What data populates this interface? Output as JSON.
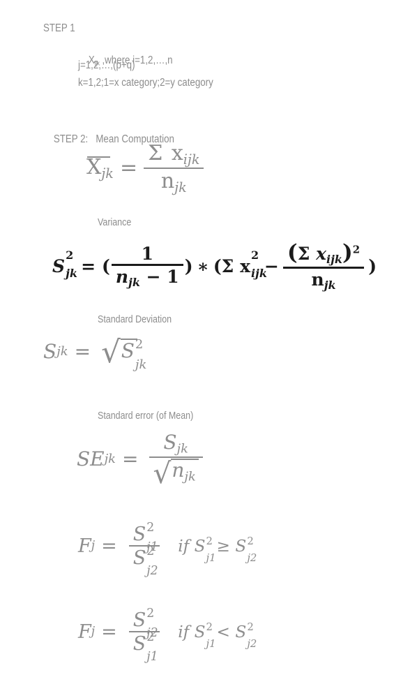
{
  "document": {
    "background_color": "#ffffff",
    "text_color_grey": "#8d8d8d",
    "text_color_dark": "#1b1b1b"
  },
  "step1": {
    "heading": "STEP 1",
    "var_symbol": "X",
    "var_subscript": "ijk",
    "line1_rest": " ,where i=1,2,…,n",
    "line2": "j=1,2,…,(p+q)",
    "line3": "k=1,2;1=x category;2=y category"
  },
  "step2": {
    "heading_prefix": "STEP 2:",
    "heading_title": "Mean Computation",
    "mean": {
      "lhs_symbol": "X",
      "lhs_sub": "jk",
      "equals": "=",
      "numerator_sigma": "Σ",
      "numerator_symbol": "x",
      "numerator_sub": "ijk",
      "denominator_symbol": "n",
      "denominator_sub": "jk"
    },
    "variance": {
      "label": "Variance",
      "lhs_symbol": "S",
      "lhs_sub": "jk",
      "lhs_sup": "2",
      "equals": "=",
      "open_paren": "(",
      "frac1_num": "1",
      "frac1_den_symbol": "n",
      "frac1_den_sub": "jk",
      "frac1_den_rest": "− 1",
      "close_paren": ")",
      "times": "∗",
      "open_paren2": "(",
      "sum_sigma": "Σ",
      "sum_symbol": "x",
      "sum_sub": "ijk",
      "sum_sup": "2",
      "minus": "−",
      "frac2_num_open": "(",
      "frac2_num_sigma": "Σ",
      "frac2_num_symbol": "x",
      "frac2_num_sub": "ijk",
      "frac2_num_close": ")",
      "frac2_num_sup": "2",
      "frac2_den_symbol": "n",
      "frac2_den_sub": "jk",
      "close_paren2": ")"
    },
    "std_dev": {
      "label": "Standard Deviation",
      "lhs_symbol": "S",
      "lhs_sub": "jk",
      "equals": "=",
      "radical": "√",
      "rad_symbol": "S",
      "rad_sub": "jk",
      "rad_sup": "2"
    },
    "std_err": {
      "label": "Standard error (of Mean)",
      "lhs_symbol": "SE",
      "lhs_sub": "jk",
      "equals": "=",
      "num_symbol": "S",
      "num_sub": "jk",
      "radical": "√",
      "den_symbol": "n",
      "den_sub": "jk"
    },
    "f_ratio_1": {
      "lhs_symbol": "F",
      "lhs_sub": "j",
      "equals": "=",
      "num_symbol": "S",
      "num_sub": "j1",
      "num_sup": "2",
      "den_symbol": "S",
      "den_sub": "j2",
      "den_sup": "2",
      "if_word": "if",
      "cond_left_symbol": "S",
      "cond_left_sub": "j1",
      "cond_left_sup": "2",
      "cond_operator": "≥",
      "cond_right_symbol": "S",
      "cond_right_sub": "j2",
      "cond_right_sup": "2"
    },
    "f_ratio_2": {
      "lhs_symbol": "F",
      "lhs_sub": "j",
      "equals": "=",
      "num_symbol": "S",
      "num_sub": "j2",
      "num_sup": "2",
      "den_symbol": "S",
      "den_sub": "j1",
      "den_sup": "2",
      "if_word": "if",
      "cond_left_symbol": "S",
      "cond_left_sub": "j1",
      "cond_left_sup": "2",
      "cond_operator": "<",
      "cond_right_symbol": "S",
      "cond_right_sub": "j2",
      "cond_right_sup": "2"
    }
  }
}
